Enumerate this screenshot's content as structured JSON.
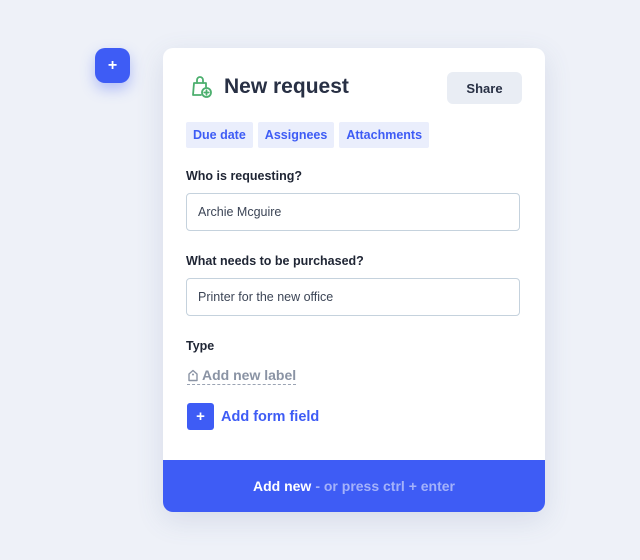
{
  "fab": {
    "label": "+",
    "icon": "plus-icon"
  },
  "header": {
    "title": "New request",
    "icon": "shopping-bag-add-icon",
    "share_label": "Share"
  },
  "chips": [
    "Due date",
    "Assignees",
    "Attachments"
  ],
  "fields": {
    "requester": {
      "label": "Who is requesting?",
      "value": "Archie Mcguire"
    },
    "purchase": {
      "label": "What needs to be purchased?",
      "value": "Printer for the new office"
    },
    "type": {
      "label": "Type"
    }
  },
  "add_label": "Add new label",
  "add_field": {
    "icon": "+",
    "label": "Add form field"
  },
  "footer": {
    "main": "Add new",
    "hint": "- or press ctrl + enter"
  },
  "colors": {
    "accent": "#3e5cf5",
    "chip_bg": "#eaeefc",
    "icon_green": "#4caf6e",
    "background": "#eef1f8"
  }
}
